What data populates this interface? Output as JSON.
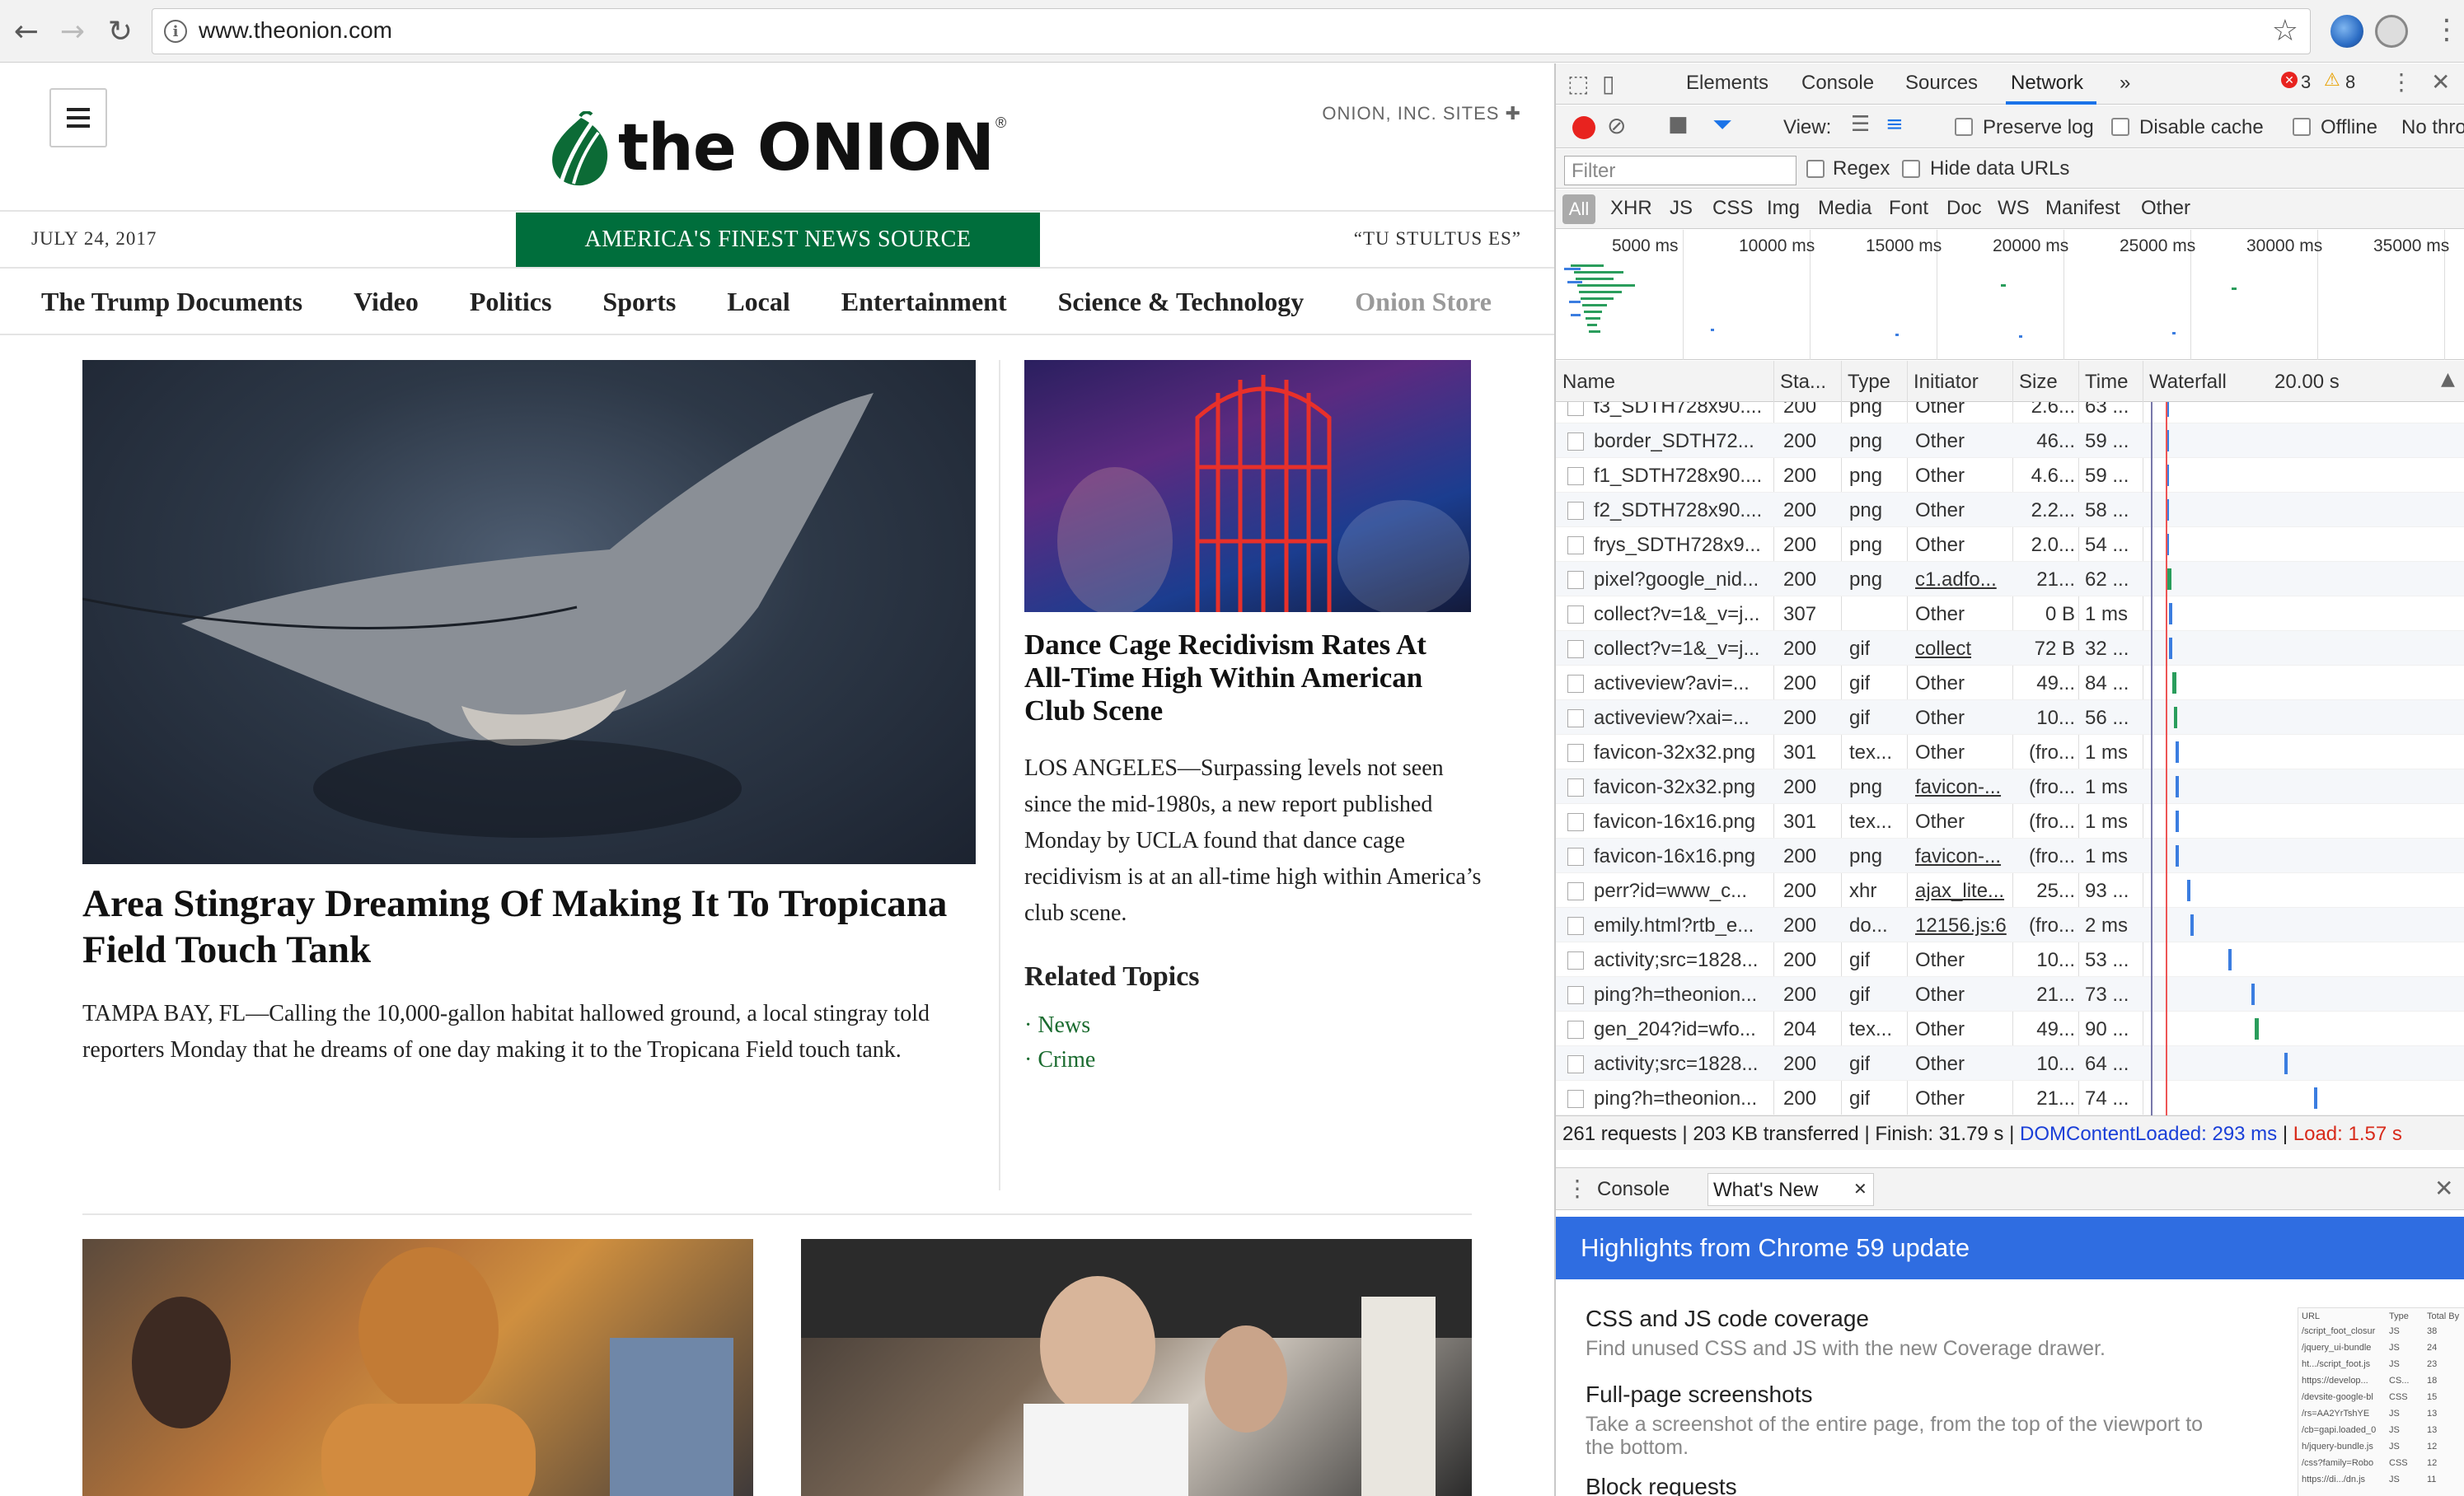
{
  "browser": {
    "url": "www.theonion.com"
  },
  "site": {
    "sites_link": "ONION, INC. SITES ✚",
    "logo_text": "the ONION",
    "logo_reg": "®",
    "date": "JULY 24, 2017",
    "tagline": "AMERICA'S FINEST NEWS SOURCE",
    "motto": "“TU STULTUS ES”",
    "nav": [
      "The Trump Documents",
      "Video",
      "Politics",
      "Sports",
      "Local",
      "Entertainment",
      "Science & Technology",
      "Onion Store"
    ],
    "main_story": {
      "title": "Area Stingray Dreaming Of Making It To Tropicana Field Touch Tank",
      "body": "TAMPA BAY, FL—Calling the 10,000-gallon habitat hallowed ground, a local stingray told reporters Monday that he dreams of one day making it to the Tropicana Field touch tank."
    },
    "side_story": {
      "title": "Dance Cage Recidivism Rates At All-Time High Within American Club Scene",
      "body": "LOS ANGELES—Surpassing levels not seen since the mid-1980s, a new report published Monday by UCLA found that dance cage recidivism is at an all-time high within America’s club scene."
    },
    "related": {
      "heading": "Related Topics",
      "items": [
        "· News",
        "· Crime"
      ]
    }
  },
  "devtools": {
    "tabs": [
      "Elements",
      "Console",
      "Sources",
      "Network",
      "»"
    ],
    "errors": "3",
    "warnings": "8",
    "toolbar": {
      "view_label": "View:",
      "preserve_log": "Preserve log",
      "disable_cache": "Disable cache",
      "offline": "Offline",
      "throttle": "No thro"
    },
    "filter": {
      "placeholder": "Filter",
      "regex": "Regex",
      "hide_data_urls": "Hide data URLs"
    },
    "types": [
      "All",
      "XHR",
      "JS",
      "CSS",
      "Img",
      "Media",
      "Font",
      "Doc",
      "WS",
      "Manifest",
      "Other"
    ],
    "timeline_ticks": [
      "5000 ms",
      "10000 ms",
      "15000 ms",
      "20000 ms",
      "25000 ms",
      "30000 ms",
      "35000 ms"
    ],
    "columns": {
      "name": "Name",
      "status": "Sta...",
      "type": "Type",
      "initiator": "Initiator",
      "size": "Size",
      "time": "Time",
      "waterfall": "Waterfall",
      "waterfall_time": "20.00 s"
    },
    "rows": [
      {
        "name": "f3_SDTH728x90....",
        "status": "200",
        "type": "png",
        "initiator": "Other",
        "size": "2.6...",
        "time": "63 ...",
        "link": false
      },
      {
        "name": "border_SDTH72...",
        "status": "200",
        "type": "png",
        "initiator": "Other",
        "size": "46...",
        "time": "59 ...",
        "link": false
      },
      {
        "name": "f1_SDTH728x90....",
        "status": "200",
        "type": "png",
        "initiator": "Other",
        "size": "4.6...",
        "time": "59 ...",
        "link": false
      },
      {
        "name": "f2_SDTH728x90....",
        "status": "200",
        "type": "png",
        "initiator": "Other",
        "size": "2.2...",
        "time": "58 ...",
        "link": false
      },
      {
        "name": "frys_SDTH728x9...",
        "status": "200",
        "type": "png",
        "initiator": "Other",
        "size": "2.0...",
        "time": "54 ...",
        "link": false
      },
      {
        "name": "pixel?google_nid...",
        "status": "200",
        "type": "png",
        "initiator": "c1.adfo...",
        "size": "21...",
        "time": "62 ...",
        "link": true
      },
      {
        "name": "collect?v=1&_v=j...",
        "status": "307",
        "type": "",
        "initiator": "Other",
        "size": "0 B",
        "time": "1 ms",
        "link": false
      },
      {
        "name": "collect?v=1&_v=j...",
        "status": "200",
        "type": "gif",
        "initiator": "collect",
        "size": "72 B",
        "time": "32 ...",
        "link": true
      },
      {
        "name": "activeview?avi=...",
        "status": "200",
        "type": "gif",
        "initiator": "Other",
        "size": "49...",
        "time": "84 ...",
        "link": false
      },
      {
        "name": "activeview?xai=...",
        "status": "200",
        "type": "gif",
        "initiator": "Other",
        "size": "10...",
        "time": "56 ...",
        "link": false
      },
      {
        "name": "favicon-32x32.png",
        "status": "301",
        "type": "tex...",
        "initiator": "Other",
        "size": "(fro...",
        "time": "1 ms",
        "link": false
      },
      {
        "name": "favicon-32x32.png",
        "status": "200",
        "type": "png",
        "initiator": "favicon-...",
        "size": "(fro...",
        "time": "1 ms",
        "link": true
      },
      {
        "name": "favicon-16x16.png",
        "status": "301",
        "type": "tex...",
        "initiator": "Other",
        "size": "(fro...",
        "time": "1 ms",
        "link": false
      },
      {
        "name": "favicon-16x16.png",
        "status": "200",
        "type": "png",
        "initiator": "favicon-...",
        "size": "(fro...",
        "time": "1 ms",
        "link": true
      },
      {
        "name": "perr?id=www_c...",
        "status": "200",
        "type": "xhr",
        "initiator": "ajax_lite...",
        "size": "25...",
        "time": "93 ...",
        "link": true
      },
      {
        "name": "emily.html?rtb_e...",
        "status": "200",
        "type": "do...",
        "initiator": "12156.js:6",
        "size": "(fro...",
        "time": "2 ms",
        "link": true
      },
      {
        "name": "activity;src=1828...",
        "status": "200",
        "type": "gif",
        "initiator": "Other",
        "size": "10...",
        "time": "53 ...",
        "link": false
      },
      {
        "name": "ping?h=theonion...",
        "status": "200",
        "type": "gif",
        "initiator": "Other",
        "size": "21...",
        "time": "73 ...",
        "link": false
      },
      {
        "name": "gen_204?id=wfo...",
        "status": "204",
        "type": "tex...",
        "initiator": "Other",
        "size": "49...",
        "time": "90 ...",
        "link": false
      },
      {
        "name": "activity;src=1828...",
        "status": "200",
        "type": "gif",
        "initiator": "Other",
        "size": "10...",
        "time": "64 ...",
        "link": false
      },
      {
        "name": "ping?h=theonion...",
        "status": "200",
        "type": "gif",
        "initiator": "Other",
        "size": "21...",
        "time": "74 ...",
        "link": false
      }
    ],
    "summary": {
      "main": "261 requests | 203 KB transferred | Finish: 31.79 s | ",
      "dcl": "DOMContentLoaded: 293 ms",
      "sep": " | ",
      "load": "Load: 1.57 s"
    },
    "drawer": {
      "console": "Console",
      "whats_new": "What's New",
      "banner": "Highlights from Chrome 59 update",
      "items": [
        {
          "title": "CSS and JS code coverage",
          "desc": "Find unused CSS and JS with the new Coverage drawer."
        },
        {
          "title": "Full-page screenshots",
          "desc": "Take a screenshot of the entire page, from the top of the viewport to the bottom."
        },
        {
          "title": "Block requests",
          "desc": ""
        }
      ],
      "thumb": {
        "headers": [
          "URL",
          "Type",
          "Total By"
        ],
        "rows": [
          [
            "/script_foot_closur",
            "JS",
            "38"
          ],
          [
            "/jquery_ui-bundle",
            "JS",
            "24"
          ],
          [
            "ht.../script_foot.js",
            "JS",
            "23"
          ],
          [
            "https://develop...",
            "CS...",
            "18"
          ],
          [
            "/devsite-google-bl",
            "CSS",
            "15"
          ],
          [
            "/rs=AA2YrTshYE",
            "JS",
            "13"
          ],
          [
            "/cb=gapi.loaded_0",
            "JS",
            "13"
          ],
          [
            "h/jquery-bundle.js",
            "JS",
            "12"
          ],
          [
            "/css?family=Robo",
            "CSS",
            "12"
          ],
          [
            "https://di.../dn.js",
            "JS",
            "11"
          ]
        ]
      }
    },
    "colors": {
      "accent": "#1a73e8",
      "record": "#e8231f",
      "dcl": "#1a3fd8",
      "load": "#d82a1a",
      "banner": "#2f6de1",
      "onion_green": "#006e3c"
    }
  }
}
